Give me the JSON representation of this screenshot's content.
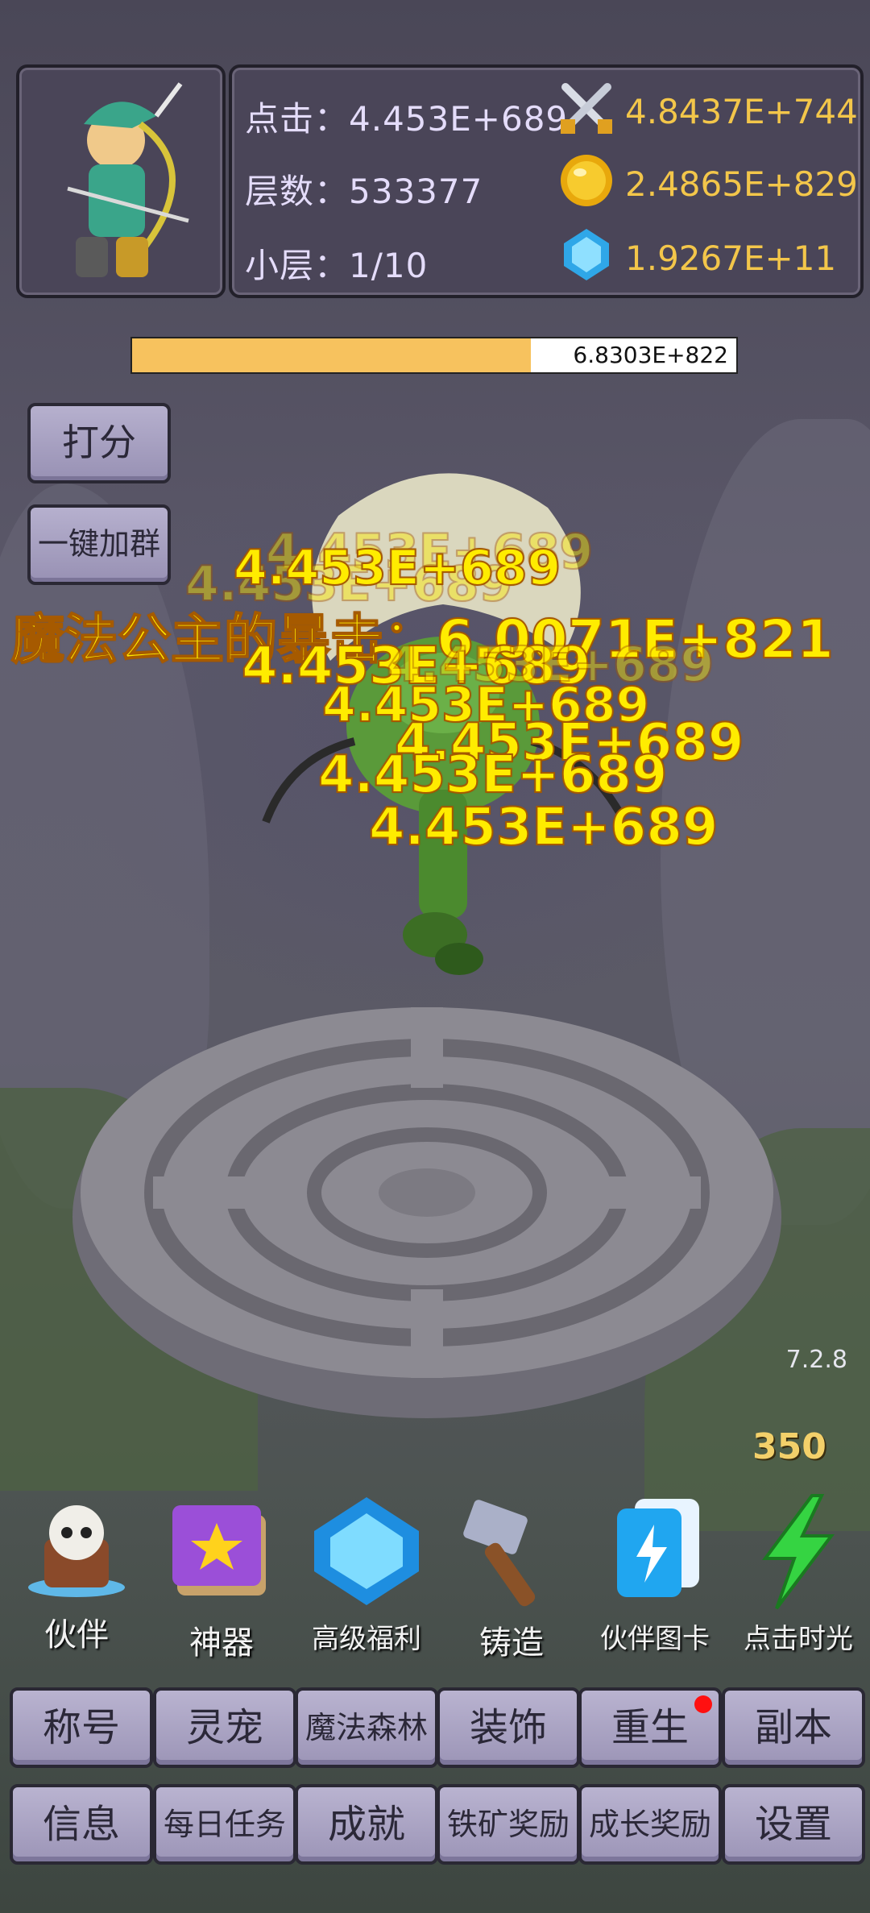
{
  "header": {
    "stats": {
      "click": "点击：4.453E+689",
      "floor": "层数：533377",
      "subfloor": "小层：1/10"
    },
    "resources": {
      "attack": "4.8437E+744",
      "gold": "2.4865E+829",
      "gems": "1.9267E+11"
    }
  },
  "boss": {
    "hp_text": "6.8303E+822",
    "hp_fraction": 0.66
  },
  "side_buttons": {
    "rate": "打分",
    "join_group": "一键加群"
  },
  "combat": {
    "crit_text": "魔法公主的暴击：6.0071E+821",
    "hit_text": "4.453E+689"
  },
  "footer": {
    "version": "7.2.8",
    "energy": "350"
  },
  "features": [
    {
      "label": "伙伴",
      "icon": "skull-partner-icon"
    },
    {
      "label": "神器",
      "icon": "artifact-book-icon"
    },
    {
      "label": "高级福利",
      "icon": "diamond-icon"
    },
    {
      "label": "铸造",
      "icon": "hammer-icon"
    },
    {
      "label": "伙伴图卡",
      "icon": "cards-icon"
    },
    {
      "label": "点击时光",
      "icon": "lightning-icon"
    }
  ],
  "menu_row1": [
    "称号",
    "灵宠",
    "魔法森林",
    "装饰",
    "重生",
    "副本"
  ],
  "menu_row2": [
    "信息",
    "每日任务",
    "成就",
    "铁矿奖励",
    "成长奖励",
    "设置"
  ],
  "colors": {
    "gold_text": "#f3c64a",
    "damage_yellow": "#ffec00",
    "notify_red": "#ff1010",
    "button_lavender": "#b6b0ce"
  }
}
